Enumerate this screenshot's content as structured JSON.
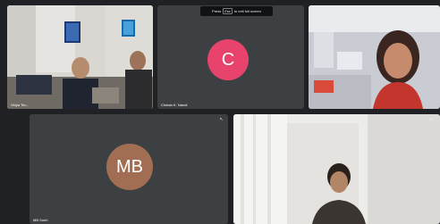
{
  "colors": {
    "background": "#202124",
    "tile": "#3c4043",
    "active_speaker_border": "#8ab4f8",
    "avatar_c": "#e8436d",
    "avatar_mb": "#a26e53"
  },
  "fullscreen_hint": {
    "prefix": "Press",
    "key": "Esc",
    "suffix": "to exit full screen"
  },
  "participants": [
    {
      "id": "vidya",
      "name": "Vidya Tev...",
      "video": true,
      "active_speaker": true
    },
    {
      "id": "chetan",
      "name": "Chetan K. Nandi",
      "video": false,
      "initials": "C"
    },
    {
      "id": "woman",
      "name": "",
      "video": true
    },
    {
      "id": "mb",
      "name": "MB Sonh",
      "video": false,
      "initials": "MB"
    },
    {
      "id": "man",
      "name": "",
      "video": true
    }
  ],
  "icons": {
    "pin": "pin-icon"
  }
}
